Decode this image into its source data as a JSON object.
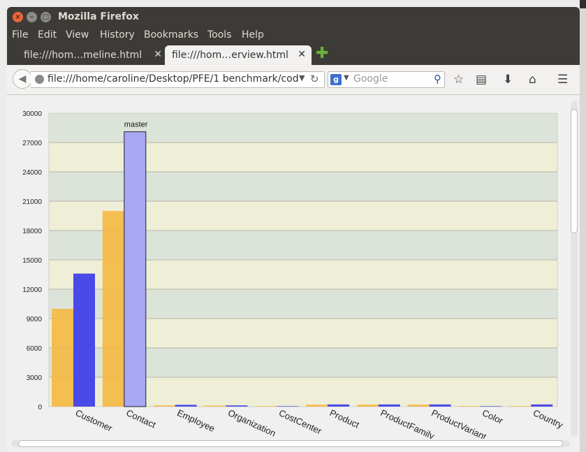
{
  "window": {
    "title": "Mozilla Firefox"
  },
  "menu": [
    "File",
    "Edit",
    "View",
    "History",
    "Bookmarks",
    "Tools",
    "Help"
  ],
  "tabs": [
    {
      "label": "file:///hom…meline.html",
      "active": false
    },
    {
      "label": "file:///hom…erview.html",
      "active": true
    }
  ],
  "navbar": {
    "url": "file:///home/caroline/Desktop/PFE/1 benchmark/cod",
    "search_placeholder": "Google"
  },
  "icons": {
    "back": "back-arrow-icon",
    "globe": "globe-icon",
    "reload": "reload-icon",
    "search": "magnifier-icon",
    "bookmark": "star-icon",
    "reading_list": "clipboard-icon",
    "download": "download-icon",
    "home": "home-icon",
    "menu": "hamburger-menu-icon",
    "new_tab": "plus-icon"
  },
  "colors": {
    "series_orange": "#f5b841",
    "series_blue": "#4a4ae8",
    "series_blue_highlight": "#a8a8f5",
    "band_light": "#efefd8",
    "band_green": "#dce4da"
  },
  "chart_data": {
    "type": "bar",
    "categories": [
      "Customer",
      "Contact",
      "Employee",
      "Organization",
      "CostCenter",
      "Product",
      "ProductFamily",
      "ProductVariant",
      "Color",
      "Country"
    ],
    "series": [
      {
        "values": [
          10000,
          20000,
          120,
          100,
          60,
          200,
          200,
          200,
          60,
          60
        ]
      },
      {
        "values": [
          13600,
          28100,
          180,
          120,
          50,
          220,
          220,
          220,
          50,
          220
        ]
      }
    ],
    "ylim": [
      0,
      30000
    ],
    "yticks": [
      0,
      3000,
      6000,
      9000,
      12000,
      15000,
      18000,
      21000,
      24000,
      27000,
      30000
    ],
    "tooltip": "master",
    "grid": true
  }
}
